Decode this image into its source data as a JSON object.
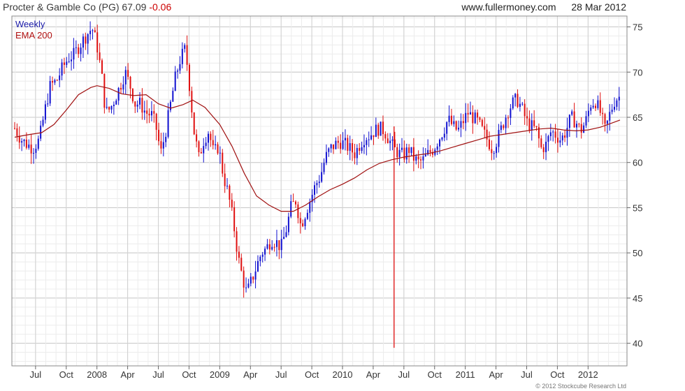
{
  "header": {
    "title": "Procter & Gamble Co (PG)",
    "price": "67.09",
    "change": "-0.06",
    "site": "www.fullermoney.com",
    "date": "28 Mar 2012"
  },
  "copyright": "© 2012 Stockcube Research Ltd",
  "colors": {
    "up": "#1010d0",
    "down": "#e01010",
    "ema": "#a01010",
    "grid": "#d8d8d8",
    "frame": "#888888"
  },
  "chart_data": {
    "type": "candlestick",
    "title": "Procter & Gamble Co (PG) 67.09 -0.06",
    "legend": [
      "Weekly",
      "EMA 200"
    ],
    "legend_position": "top-left",
    "grid": true,
    "y_axis_side": "right",
    "ylim": [
      37.5,
      76.2
    ],
    "y_ticks": [
      40,
      45,
      50,
      55,
      60,
      65,
      70,
      75
    ],
    "x_range": [
      2007.33,
      2012.26
    ],
    "x_ticks": [
      {
        "label": "Jul",
        "x": 2007.5
      },
      {
        "label": "Oct",
        "x": 2007.75
      },
      {
        "label": "2008",
        "x": 2008.0
      },
      {
        "label": "Apr",
        "x": 2008.25
      },
      {
        "label": "Jul",
        "x": 2008.5
      },
      {
        "label": "Oct",
        "x": 2008.75
      },
      {
        "label": "2009",
        "x": 2009.0
      },
      {
        "label": "Apr",
        "x": 2009.25
      },
      {
        "label": "Jul",
        "x": 2009.5
      },
      {
        "label": "Oct",
        "x": 2009.75
      },
      {
        "label": "2010",
        "x": 2010.0
      },
      {
        "label": "Apr",
        "x": 2010.25
      },
      {
        "label": "Jul",
        "x": 2010.5
      },
      {
        "label": "Oct",
        "x": 2010.75
      },
      {
        "label": "2011",
        "x": 2011.0
      },
      {
        "label": "Apr",
        "x": 2011.25
      },
      {
        "label": "Jul",
        "x": 2011.5
      },
      {
        "label": "Oct",
        "x": 2011.75
      },
      {
        "label": "2012",
        "x": 2012.0
      }
    ],
    "close_series": [
      [
        2007.33,
        63.8
      ],
      [
        2007.38,
        62.6
      ],
      [
        2007.43,
        62.0
      ],
      [
        2007.48,
        61.6
      ],
      [
        2007.53,
        62.5
      ],
      [
        2007.58,
        66.0
      ],
      [
        2007.62,
        68.5
      ],
      [
        2007.67,
        69.0
      ],
      [
        2007.72,
        70.5
      ],
      [
        2007.77,
        71.6
      ],
      [
        2007.81,
        71.9
      ],
      [
        2007.86,
        73.0
      ],
      [
        2007.91,
        74.0
      ],
      [
        2007.96,
        74.9
      ],
      [
        2008.0,
        73.0
      ],
      [
        2008.04,
        69.5
      ],
      [
        2008.07,
        65.5
      ],
      [
        2008.11,
        66.0
      ],
      [
        2008.15,
        67.2
      ],
      [
        2008.19,
        68.5
      ],
      [
        2008.23,
        70.0
      ],
      [
        2008.27,
        68.5
      ],
      [
        2008.31,
        66.5
      ],
      [
        2008.35,
        66.5
      ],
      [
        2008.4,
        65.5
      ],
      [
        2008.45,
        65.2
      ],
      [
        2008.48,
        64.0
      ],
      [
        2008.52,
        61.0
      ],
      [
        2008.56,
        63.5
      ],
      [
        2008.6,
        66.5
      ],
      [
        2008.64,
        69.5
      ],
      [
        2008.68,
        71.5
      ],
      [
        2008.72,
        72.6
      ],
      [
        2008.75,
        69.0
      ],
      [
        2008.79,
        63.5
      ],
      [
        2008.83,
        60.5
      ],
      [
        2008.87,
        62.5
      ],
      [
        2008.91,
        63.5
      ],
      [
        2008.95,
        61.0
      ],
      [
        2008.99,
        61.8
      ],
      [
        2009.03,
        58.5
      ],
      [
        2009.07,
        56.5
      ],
      [
        2009.11,
        53.5
      ],
      [
        2009.15,
        49.5
      ],
      [
        2009.19,
        47.0
      ],
      [
        2009.22,
        45.5
      ],
      [
        2009.26,
        47.0
      ],
      [
        2009.3,
        48.5
      ],
      [
        2009.34,
        50.0
      ],
      [
        2009.38,
        50.5
      ],
      [
        2009.42,
        51.5
      ],
      [
        2009.46,
        51.2
      ],
      [
        2009.5,
        50.6
      ],
      [
        2009.54,
        52.5
      ],
      [
        2009.58,
        55.0
      ],
      [
        2009.62,
        55.8
      ],
      [
        2009.66,
        53.0
      ],
      [
        2009.7,
        54.5
      ],
      [
        2009.74,
        56.0
      ],
      [
        2009.78,
        57.5
      ],
      [
        2009.82,
        58.5
      ],
      [
        2009.86,
        60.5
      ],
      [
        2009.9,
        61.5
      ],
      [
        2009.94,
        62.0
      ],
      [
        2009.98,
        62.3
      ],
      [
        2010.02,
        62.0
      ],
      [
        2010.06,
        61.5
      ],
      [
        2010.1,
        61.0
      ],
      [
        2010.14,
        62.0
      ],
      [
        2010.18,
        62.8
      ],
      [
        2010.22,
        63.0
      ],
      [
        2010.26,
        63.5
      ],
      [
        2010.3,
        63.8
      ],
      [
        2010.34,
        63.5
      ],
      [
        2010.38,
        62.5
      ],
      [
        2010.42,
        61.5
      ],
      [
        2010.46,
        61.0
      ],
      [
        2010.5,
        60.8
      ],
      [
        2010.54,
        61.5
      ],
      [
        2010.58,
        60.5
      ],
      [
        2010.62,
        60.0
      ],
      [
        2010.66,
        60.3
      ],
      [
        2010.7,
        61.0
      ],
      [
        2010.74,
        61.5
      ],
      [
        2010.78,
        62.5
      ],
      [
        2010.82,
        63.5
      ],
      [
        2010.86,
        64.8
      ],
      [
        2010.9,
        64.0
      ],
      [
        2010.94,
        63.5
      ],
      [
        2010.98,
        64.5
      ],
      [
        2011.02,
        65.5
      ],
      [
        2011.06,
        65.0
      ],
      [
        2011.1,
        64.5
      ],
      [
        2011.14,
        63.5
      ],
      [
        2011.18,
        62.5
      ],
      [
        2011.22,
        61.5
      ],
      [
        2011.26,
        62.5
      ],
      [
        2011.3,
        64.0
      ],
      [
        2011.34,
        65.5
      ],
      [
        2011.38,
        66.5
      ],
      [
        2011.42,
        67.0
      ],
      [
        2011.46,
        66.0
      ],
      [
        2011.5,
        64.5
      ],
      [
        2011.54,
        64.0
      ],
      [
        2011.58,
        63.5
      ],
      [
        2011.62,
        61.5
      ],
      [
        2011.66,
        62.0
      ],
      [
        2011.7,
        63.5
      ],
      [
        2011.74,
        63.0
      ],
      [
        2011.78,
        62.5
      ],
      [
        2011.82,
        63.5
      ],
      [
        2011.86,
        65.0
      ],
      [
        2011.9,
        64.5
      ],
      [
        2011.94,
        63.5
      ],
      [
        2011.98,
        64.5
      ],
      [
        2012.02,
        66.5
      ],
      [
        2012.06,
        66.8
      ],
      [
        2012.1,
        65.5
      ],
      [
        2012.14,
        63.5
      ],
      [
        2012.18,
        65.5
      ],
      [
        2012.22,
        67.0
      ],
      [
        2012.26,
        67.3
      ]
    ],
    "ema_200": [
      [
        2007.33,
        62.8
      ],
      [
        2007.45,
        63.1
      ],
      [
        2007.55,
        63.3
      ],
      [
        2007.65,
        64.2
      ],
      [
        2007.75,
        65.8
      ],
      [
        2007.85,
        67.5
      ],
      [
        2007.95,
        68.3
      ],
      [
        2008.0,
        68.5
      ],
      [
        2008.1,
        68.2
      ],
      [
        2008.2,
        67.6
      ],
      [
        2008.3,
        67.4
      ],
      [
        2008.4,
        67.5
      ],
      [
        2008.5,
        66.5
      ],
      [
        2008.6,
        66.0
      ],
      [
        2008.7,
        66.4
      ],
      [
        2008.78,
        66.9
      ],
      [
        2008.88,
        66.1
      ],
      [
        2009.0,
        64.2
      ],
      [
        2009.1,
        61.8
      ],
      [
        2009.2,
        58.8
      ],
      [
        2009.3,
        56.3
      ],
      [
        2009.4,
        55.3
      ],
      [
        2009.5,
        54.6
      ],
      [
        2009.6,
        54.6
      ],
      [
        2009.7,
        55.3
      ],
      [
        2009.8,
        56.2
      ],
      [
        2009.9,
        57.0
      ],
      [
        2010.0,
        57.6
      ],
      [
        2010.1,
        58.3
      ],
      [
        2010.2,
        59.2
      ],
      [
        2010.3,
        59.9
      ],
      [
        2010.4,
        60.3
      ],
      [
        2010.5,
        60.6
      ],
      [
        2010.6,
        60.8
      ],
      [
        2010.7,
        61.0
      ],
      [
        2010.8,
        61.3
      ],
      [
        2010.9,
        61.7
      ],
      [
        2011.0,
        62.1
      ],
      [
        2011.1,
        62.5
      ],
      [
        2011.2,
        62.9
      ],
      [
        2011.3,
        63.1
      ],
      [
        2011.4,
        63.3
      ],
      [
        2011.5,
        63.5
      ],
      [
        2011.6,
        63.7
      ],
      [
        2011.7,
        63.8
      ],
      [
        2011.8,
        63.6
      ],
      [
        2011.9,
        63.5
      ],
      [
        2012.0,
        63.6
      ],
      [
        2012.1,
        63.9
      ],
      [
        2012.2,
        64.4
      ],
      [
        2012.26,
        64.7
      ]
    ],
    "spike": {
      "x": 2010.42,
      "low": 39.5,
      "high": 64.0
    }
  }
}
